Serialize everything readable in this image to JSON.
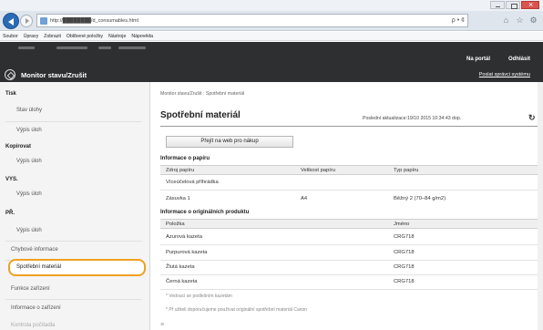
{
  "browser": {
    "address_visible": "http://████████/d_consumables.html",
    "address_tools": "ρ • ¢",
    "tool_icons": [
      "home-icon",
      "star-icon",
      "settings-icon"
    ]
  },
  "menubar": {
    "items": [
      "Soubor",
      "Úpravy",
      "Zobrazit",
      "Oblíbené položky",
      "Nástroje",
      "Nápověda"
    ]
  },
  "header": {
    "brand_title": "Monitor stavu/Zrušit",
    "portal_label": "Na portál",
    "logout_label": "Odhlásit",
    "sysmgr_label": "Poslat správci systému"
  },
  "sidebar": {
    "groups": [
      {
        "title": "Tisk",
        "items": [
          "Stav úlohy",
          "Výpis úloh"
        ]
      },
      {
        "title": "Kopírovat",
        "items": [
          "Výpis úloh"
        ]
      },
      {
        "title": "VYS.",
        "items": [
          "Výpis úloh"
        ]
      },
      {
        "title": "PŘ.",
        "items": [
          "Výpis úloh"
        ]
      }
    ],
    "extras": [
      "Chybové informace",
      "Spotřební materiál",
      "Funkce zařízení",
      "Informace o zařízení",
      "Kontrola počítadla"
    ],
    "active": "Spotřební materiál"
  },
  "main": {
    "breadcrumb": "Monitor stavu/Zrušit : Spotřební materiál",
    "title": "Spotřební materiál",
    "last_update": "Poslední aktualizace:19/10 2015 10:34:43 dop.",
    "buy_button": "Přejít na web pro nákup",
    "paper_section": {
      "title": "Informace o papíru",
      "headers": [
        "Zdroj papíru",
        "Velikost papíru",
        "Typ papíru"
      ],
      "rows": [
        [
          "Víceúčelová příhrádka",
          "",
          ""
        ],
        [
          "Zásuvka 1",
          "A4",
          "Běžný 2 (70–84 g/m2)"
        ]
      ]
    },
    "original_section": {
      "title": "Informace o originálních produktu",
      "headers": [
        "Položka",
        "Jméno"
      ],
      "rows": [
        [
          "Azurová kazeta",
          "CRG718"
        ],
        [
          "Purpurová kazeta",
          "CRG718"
        ],
        [
          "Žlutá kazeta",
          "CRG718"
        ],
        [
          "Černá kazeta",
          "CRG718"
        ]
      ]
    },
    "notes": [
      "* Vedoucí se podlešním kazetám",
      "* Př užiteli doporučujeme používat originální spotřební materiál Canon"
    ],
    "footer_mark": "≡"
  },
  "colors": {
    "header_bg": "#2e2f31",
    "active_highlight": "#f0a020",
    "back_button": "#2a6bb8"
  }
}
